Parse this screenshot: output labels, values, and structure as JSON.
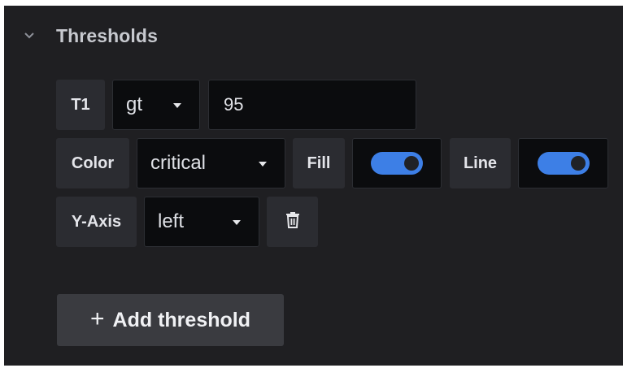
{
  "section": {
    "title": "Thresholds",
    "icon": "chevron-down-icon"
  },
  "threshold": {
    "name": "T1",
    "operator": "gt",
    "value": "95",
    "color_label": "Color",
    "color_value": "critical",
    "fill_label": "Fill",
    "fill_enabled": true,
    "line_label": "Line",
    "line_enabled": true,
    "yaxis_label": "Y-Axis",
    "yaxis_value": "left",
    "delete_icon": "trash-icon"
  },
  "add_button": {
    "label": "Add threshold",
    "icon": "plus-icon"
  },
  "colors": {
    "toggle_on": "#3d7fe6",
    "panel_bg": "#1f1f22",
    "input_bg": "#0b0c0e"
  }
}
